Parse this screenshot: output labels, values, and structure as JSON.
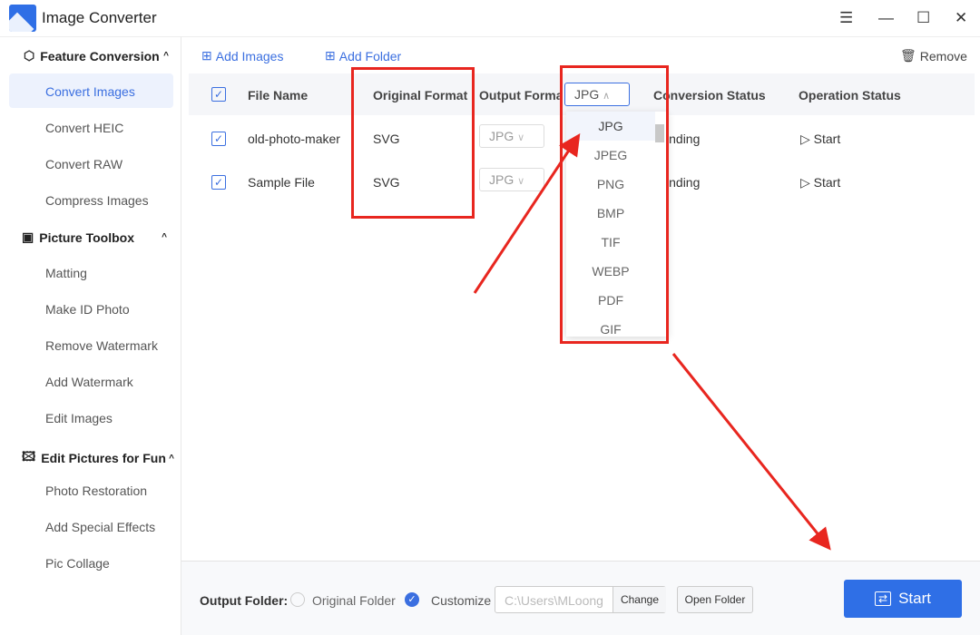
{
  "app": {
    "title": "Image Converter"
  },
  "window": {
    "menu": "☰",
    "minimize": "—",
    "maximize": "☐",
    "close": "✕"
  },
  "sidebar": {
    "sections": [
      {
        "label": "Feature Conversion",
        "items": [
          "Convert Images",
          "Convert HEIC",
          "Convert RAW",
          "Compress Images"
        ]
      },
      {
        "label": "Picture Toolbox",
        "items": [
          "Matting",
          "Make ID Photo",
          "Remove Watermark",
          "Add Watermark",
          "Edit Images"
        ]
      },
      {
        "label": "Edit Pictures for Fun",
        "items": [
          "Photo Restoration",
          "Add Special Effects",
          "Pic Collage"
        ]
      }
    ],
    "active": "Convert Images"
  },
  "toolbar": {
    "add_images": "Add Images",
    "add_folder": "Add Folder",
    "remove": "Remove"
  },
  "table": {
    "headers": [
      "File Name",
      "Original Format",
      "Output Format",
      "Conversion Status",
      "Operation Status"
    ],
    "header_format": "JPG",
    "rows": [
      {
        "name": "old-photo-maker",
        "original": "SVG",
        "output": "JPG",
        "status": "Pending",
        "op": "Start"
      },
      {
        "name": "Sample File",
        "original": "SVG",
        "output": "JPG",
        "status": "Pending",
        "op": "Start"
      }
    ]
  },
  "dropdown": {
    "options": [
      "JPG",
      "JPEG",
      "PNG",
      "BMP",
      "TIF",
      "WEBP",
      "PDF",
      "GIF"
    ],
    "selected": "JPG"
  },
  "bottom": {
    "label": "Output Folder:",
    "original": "Original Folder",
    "customize": "Customize",
    "path": "C:\\Users\\MLoong",
    "change": "Change",
    "open": "Open Folder",
    "start": "Start"
  },
  "colors": {
    "accent": "#3b6fe0",
    "annotation": "#e8261f"
  }
}
